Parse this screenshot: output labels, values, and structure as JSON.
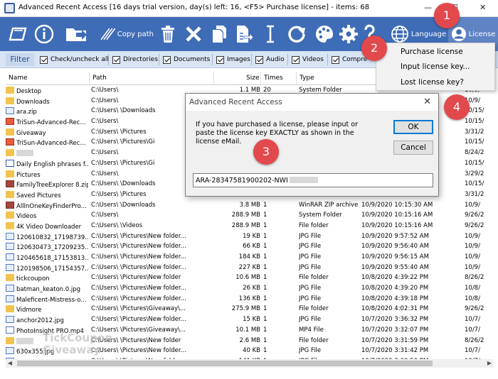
{
  "window": {
    "title": "Advanced Recent Access [16 days trial version,  day(s) left: 16, <F5> Purchase license] - items: 68"
  },
  "toolbar": {
    "copy_path_label": "Copy path",
    "language_label": "Language",
    "license_label": "License"
  },
  "filter": {
    "button": "Filter",
    "checks": [
      "Check/uncheck all",
      "Directories",
      "Documents",
      "Images",
      "Audio",
      "Videos",
      "Compre"
    ]
  },
  "columns": {
    "name": "Name",
    "path": "Path",
    "size": "Size",
    "times": "Times",
    "type": "Type"
  },
  "rows": [
    {
      "icon": "folder",
      "name": "Desktop",
      "path": "C:\\Users\\",
      "size": "1.1 MB",
      "times": "20",
      "type": "System Folder",
      "date": "",
      "last": "10/9/"
    },
    {
      "icon": "folder",
      "name": "Downloads",
      "path": "C:\\Users\\",
      "size": "",
      "times": "",
      "type": "",
      "date": "",
      "last": "10/9/"
    },
    {
      "icon": "img",
      "name": "ara.zip",
      "path": "C:\\Users\\ \\Downloads",
      "size": "",
      "times": "",
      "type": "",
      "date": "",
      "last": "10/15/"
    },
    {
      "icon": "exe",
      "name": "TriSun-Advanced-Rec...",
      "path": "C:\\Users\\",
      "size": "",
      "times": "",
      "type": "",
      "date": "",
      "last": "10/15/"
    },
    {
      "icon": "folder",
      "name": "Giveaway",
      "path": "C:\\Users\\ \\Pictures",
      "size": "",
      "times": "",
      "type": "",
      "date": "",
      "last": "3/31/2"
    },
    {
      "icon": "exe",
      "name": "TriSun-Advanced-Rec...",
      "path": "C:\\Users\\ \\Pictures\\Gi",
      "size": "",
      "times": "",
      "type": "",
      "date": "",
      "last": "10/15/"
    },
    {
      "icon": "folder",
      "name": "",
      "path": "C:\\Users\\",
      "size": "",
      "times": "",
      "type": "",
      "date": "",
      "last": "8/24/2"
    },
    {
      "icon": "doc",
      "name": "Daily English phrases f...",
      "path": "C:\\Users\\ \\Pictures\\Gi",
      "size": "",
      "times": "",
      "type": "",
      "date": "",
      "last": "10/15/"
    },
    {
      "icon": "folder",
      "name": "Pictures",
      "path": "C:\\Users\\",
      "size": "",
      "times": "",
      "type": "",
      "date": "",
      "last": "3/29/2"
    },
    {
      "icon": "zip",
      "name": "FamilyTreeExplorer 8.zip",
      "path": "C:\\Users\\ \\Downloads",
      "size": "",
      "times": "",
      "type": "",
      "date": "",
      "last": "10/15/"
    },
    {
      "icon": "folder",
      "name": "Saved Pictures",
      "path": "C:\\Users\\ \\Pictures",
      "size": "",
      "times": "",
      "type": "",
      "date": "",
      "last": "3/31/2"
    },
    {
      "icon": "zip",
      "name": "AllInOneKeyFinderPro...",
      "path": "C:\\Users\\ \\Downloads",
      "size": "3.8 MB",
      "times": "1",
      "type": "WinRAR ZIP archive",
      "date": "10/9/2020 10:15:30 AM",
      "last": "10/9/"
    },
    {
      "icon": "folder",
      "name": "Videos",
      "path": "C:\\Users\\",
      "size": "288.9 MB",
      "times": "1",
      "type": "System Folder",
      "date": "10/9/2020 10:15:16 AM",
      "last": "9/26/2"
    },
    {
      "icon": "folder",
      "name": "4K Video Downloader",
      "path": "C:\\Users\\ \\Videos",
      "size": "288.9 MB",
      "times": "1",
      "type": "File folder",
      "date": "10/9/2020 10:15:16 AM",
      "last": "9/26/2"
    },
    {
      "icon": "img",
      "name": "120610832_17198739...",
      "path": "C:\\Users\\ \\Pictures\\New folder...",
      "size": "19 KB",
      "times": "1",
      "type": "JPG File",
      "date": "10/9/2020 9:57:52 AM",
      "last": "10/9/"
    },
    {
      "icon": "img",
      "name": "120630473_17209235...",
      "path": "C:\\Users\\ \\Pictures\\New folder...",
      "size": "66 KB",
      "times": "1",
      "type": "JPG File",
      "date": "10/9/2020 9:56:40 AM",
      "last": "10/9/"
    },
    {
      "icon": "img",
      "name": "120465618_17153813...",
      "path": "C:\\Users\\ \\Pictures\\New folder...",
      "size": "184 KB",
      "times": "1",
      "type": "JPG File",
      "date": "10/9/2020 9:56:15 AM",
      "last": "10/9/"
    },
    {
      "icon": "img",
      "name": "120198506_17154357...",
      "path": "C:\\Users\\ \\Pictures\\New folder...",
      "size": "227 KB",
      "times": "1",
      "type": "JPG File",
      "date": "10/9/2020 9:55:40 AM",
      "last": "10/9/"
    },
    {
      "icon": "folder",
      "name": "tickcoupon",
      "path": "C:\\Users\\ \\Pictures\\New folder",
      "size": "10.6 MB",
      "times": "1",
      "type": "File folder",
      "date": "10/8/2020 4:39:22 PM",
      "last": "8/26/2"
    },
    {
      "icon": "img",
      "name": "batman_keaton.0.jpg",
      "path": "C:\\Users\\ \\Pictures\\New folder...",
      "size": "26 KB",
      "times": "1",
      "type": "JPG File",
      "date": "10/8/2020 4:39:20 PM",
      "last": "10/8/"
    },
    {
      "icon": "img",
      "name": "Maleficent-Mistress-o...",
      "path": "C:\\Users\\ \\Pictures\\New folder...",
      "size": "136 KB",
      "times": "1",
      "type": "JPG File",
      "date": "10/8/2020 4:39:18 PM",
      "last": "10/8/"
    },
    {
      "icon": "folder",
      "name": "Vidmore",
      "path": "C:\\Users\\ \\Pictures\\Giveaway\\...",
      "size": "275.9 MB",
      "times": "1",
      "type": "File folder",
      "date": "10/8/2020 4:02:31 PM",
      "last": "9/26/2"
    },
    {
      "icon": "img",
      "name": "anchor2012.jpg",
      "path": "C:\\Users\\ \\Pictures\\New folder...",
      "size": "15 KB",
      "times": "1",
      "type": "JPG File",
      "date": "10/7/2020 3:36:32 PM",
      "last": "10/7/"
    },
    {
      "icon": "vid",
      "name": "PhotoInsight PRO.mp4",
      "path": "C:\\Users\\ \\Pictures\\Giveaway\\...",
      "size": "10.1 MB",
      "times": "1",
      "type": "MP4 File",
      "date": "10/7/2020 3:32:07 PM",
      "last": "10/7/"
    },
    {
      "icon": "folder",
      "name": "",
      "path": "C:\\Users\\ \\Pictures\\New folder",
      "size": "2.6 MB",
      "times": "1",
      "type": "File folder",
      "date": "10/7/2020 3:31:59 PM",
      "last": "8/26/2"
    },
    {
      "icon": "img",
      "name": "630x355.jpg",
      "path": "C:\\Users\\ \\Pictures\\New folder...",
      "size": "40 KB",
      "times": "1",
      "type": "JPG File",
      "date": "10/7/2020 3:31:42 PM",
      "last": "10/7/"
    },
    {
      "icon": "img",
      "name": "7-signs-of-a-true-frie...",
      "path": "C:\\Users\\ \\Pictures\\New folder...",
      "size": "141 KB",
      "times": "1",
      "type": "JPG File",
      "date": "10/7/2020 3:30:50 PM",
      "last": "10/7/"
    }
  ],
  "license_menu": [
    "Purchase license",
    "Input license key...",
    "Lost license key?"
  ],
  "dialog": {
    "title": "Advanced Recent Access",
    "message": "If you have purchased a license, please input or paste the license key EXACTLY as shown in the license eMail.",
    "key_value": "ARA-28347581900202-NWI",
    "ok": "OK",
    "cancel": "Cancel"
  },
  "badges": [
    "1",
    "2",
    "3",
    "4"
  ],
  "watermark": {
    "line1": "TickCoupon",
    "line2": "Giveaway"
  },
  "colors": {
    "toolbar": "#3f6cb6",
    "filterbar": "#d9e5f5",
    "badge": "#e2494d",
    "focus": "#0078d7"
  }
}
